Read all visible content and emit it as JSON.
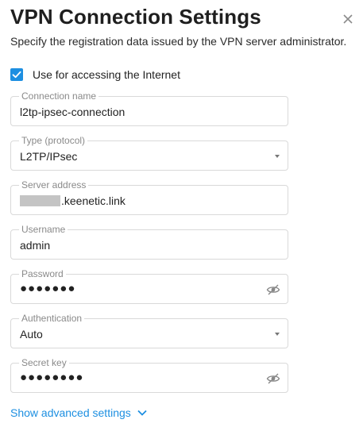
{
  "dialog": {
    "title": "VPN Connection Settings",
    "subtitle": "Specify the registration data issued by the VPN server administrator."
  },
  "internet_checkbox": {
    "label": "Use for accessing the Internet",
    "checked": true
  },
  "fields": {
    "connection_name": {
      "label": "Connection name",
      "value": "l2tp-ipsec-connection"
    },
    "type": {
      "label": "Type (protocol)",
      "value": "L2TP/IPsec"
    },
    "server_address": {
      "label": "Server address",
      "value": ".keenetic.link"
    },
    "username": {
      "label": "Username",
      "value": "admin"
    },
    "password": {
      "label": "Password",
      "value": "●●●●●●●"
    },
    "authentication": {
      "label": "Authentication",
      "value": "Auto"
    },
    "secret_key": {
      "label": "Secret key",
      "value": "●●●●●●●●"
    }
  },
  "advanced_link": {
    "label": "Show advanced settings"
  },
  "colors": {
    "accent": "#1d8fe1",
    "border": "#d9d9d9",
    "legend": "#8a8a8a"
  },
  "icons": {
    "close": "close-icon",
    "checkbox": "checkmark-icon",
    "password_toggle": "eye-off-icon",
    "dropdown": "caret-down-icon",
    "expand": "chevron-down-icon"
  }
}
